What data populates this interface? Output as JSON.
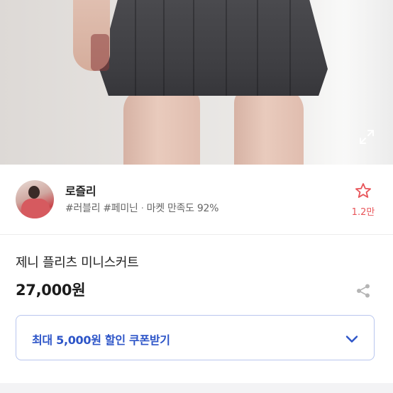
{
  "hero": {
    "icon": "expand-icon"
  },
  "seller": {
    "name": "로즐리",
    "tags": "#러블리 #페미닌",
    "satisfaction": "마켓 만족도 92%",
    "favorite_icon": "star-icon",
    "favorite_count": "1.2만",
    "accent_color": "#e8555a"
  },
  "product": {
    "title": "제니 플리츠 미니스커트",
    "price": "27,000원",
    "share_icon": "share-icon"
  },
  "coupon": {
    "label": "최대 5,000원 할인 쿠폰받기",
    "icon": "chevron-down-icon",
    "color": "#2d55c8"
  }
}
